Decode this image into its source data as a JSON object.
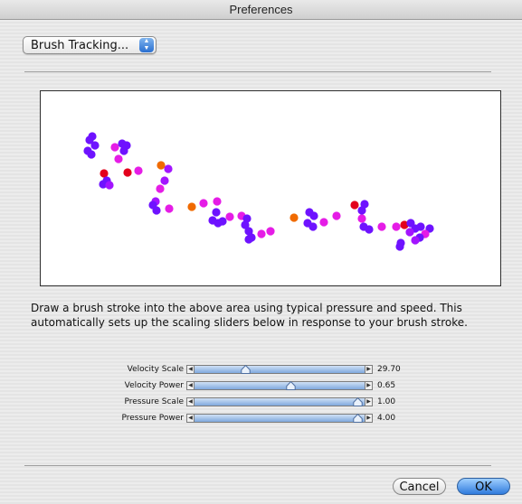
{
  "window": {
    "title": "Preferences"
  },
  "popup": {
    "label": "Brush Tracking...",
    "arrow_icon": "up-down-arrows-icon"
  },
  "canvas": {
    "description_icon": "brush-stroke-trail",
    "colors": {
      "violet": "#6e12ff",
      "magenta": "#e51ce6",
      "purple": "#a314ff",
      "red": "#e3001c",
      "orange": "#f06a00"
    }
  },
  "instructions": {
    "line1": "Draw a brush stroke into the above area using typical pressure and speed.  This",
    "line2": "automatically sets up the scaling sliders below in response to your brush stroke."
  },
  "sliders": [
    {
      "label": "Velocity Scale",
      "value": "29.70",
      "level": 0.3
    },
    {
      "label": "Velocity Power",
      "value": "0.65",
      "level": 0.57
    },
    {
      "label": "Pressure Scale",
      "value": "1.00",
      "level": 0.97
    },
    {
      "label": "Pressure Power",
      "value": "4.00",
      "level": 0.97
    }
  ],
  "buttons": {
    "cancel": "Cancel",
    "ok": "OK"
  },
  "accent": "#2f7bdc"
}
